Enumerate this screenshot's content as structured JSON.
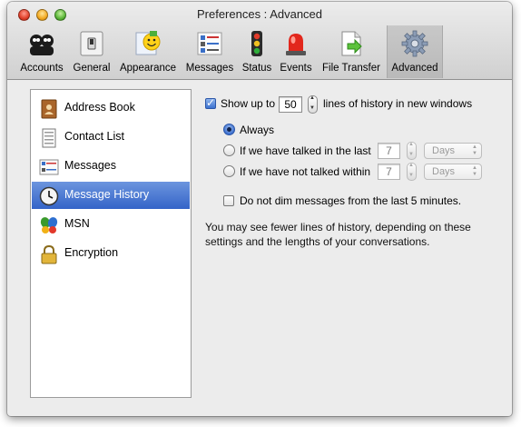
{
  "window": {
    "title": "Preferences : Advanced"
  },
  "toolbar": {
    "items": [
      {
        "label": "Accounts",
        "icon": "accounts-icon"
      },
      {
        "label": "General",
        "icon": "switch-icon"
      },
      {
        "label": "Appearance",
        "icon": "smiley-icon"
      },
      {
        "label": "Messages",
        "icon": "messages-icon"
      },
      {
        "label": "Status",
        "icon": "traffic-light-icon"
      },
      {
        "label": "Events",
        "icon": "siren-icon"
      },
      {
        "label": "File Transfer",
        "icon": "file-transfer-icon"
      },
      {
        "label": "Advanced",
        "icon": "gear-icon",
        "selected": true
      }
    ]
  },
  "sidebar": {
    "items": [
      {
        "label": "Address Book",
        "icon": "address-book-icon"
      },
      {
        "label": "Contact List",
        "icon": "contact-list-icon"
      },
      {
        "label": "Messages",
        "icon": "messages-icon"
      },
      {
        "label": "Message History",
        "icon": "clock-icon",
        "selected": true
      },
      {
        "label": "MSN",
        "icon": "msn-butterfly-icon"
      },
      {
        "label": "Encryption",
        "icon": "padlock-icon"
      }
    ]
  },
  "history": {
    "show_up_to_label": "Show up to",
    "show_up_to_checked": true,
    "lines_value": "50",
    "lines_suffix": "lines of history in new windows",
    "options": [
      {
        "label": "Always",
        "selected": true
      },
      {
        "label": "If we have talked in the last",
        "value": "7",
        "unit": "Days"
      },
      {
        "label": "If we have not talked within",
        "value": "7",
        "unit": "Days"
      }
    ],
    "no_dim_label": "Do not dim messages from the last 5 minutes.",
    "no_dim_checked": false,
    "note_line1": "You may see fewer lines of history, depending on these",
    "note_line2": "settings and the lengths of your conversations."
  }
}
